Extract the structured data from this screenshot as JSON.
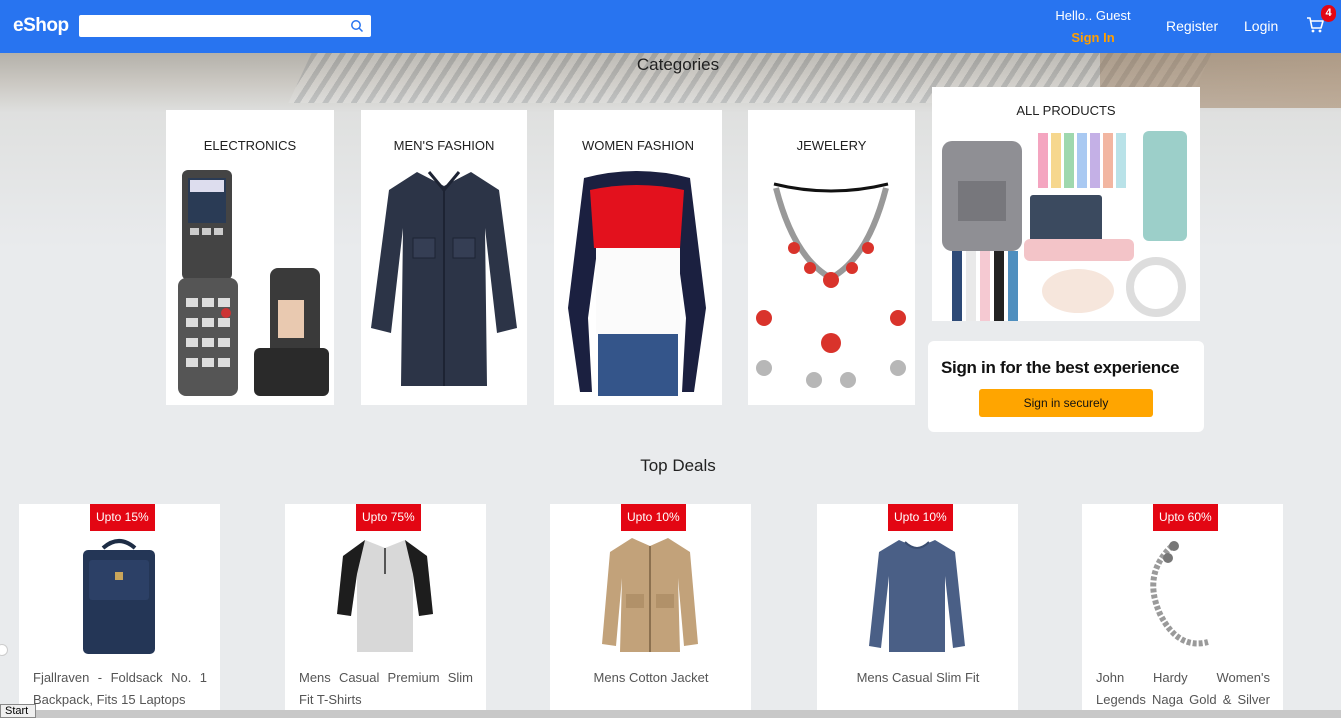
{
  "header": {
    "logo": "eShop",
    "search_placeholder": "",
    "greeting": "Hello.. Guest",
    "sign_in": "Sign In",
    "register": "Register",
    "login": "Login",
    "cart_count": "4"
  },
  "categories_title": "Categories",
  "categories": [
    {
      "label": "ELECTRONICS"
    },
    {
      "label": "MEN'S FASHION"
    },
    {
      "label": "WOMEN FASHION"
    },
    {
      "label": "JEWELERY"
    },
    {
      "label": "ALL PRODUCTS"
    }
  ],
  "signin_card": {
    "text": "Sign in for the best experience",
    "button": "Sign in securely"
  },
  "top_deals_title": "Top Deals",
  "deals": [
    {
      "badge": "Upto 15%",
      "name": "Fjallraven - Foldsack No. 1 Backpack, Fits 15 Laptops"
    },
    {
      "badge": "Upto 75%",
      "name": "Mens Casual Premium Slim Fit T-Shirts"
    },
    {
      "badge": "Upto 10%",
      "name": "Mens Cotton Jacket"
    },
    {
      "badge": "Upto 10%",
      "name": "Mens Casual Slim Fit"
    },
    {
      "badge": "Upto 60%",
      "name": "John Hardy Women's Legends Naga Gold & Silver Drag..."
    }
  ],
  "taskbar": {
    "start": "Start"
  },
  "colors": {
    "header": "#2874f0",
    "accent": "#ff9f00",
    "badge": "#e30613",
    "button": "#ffa500"
  }
}
